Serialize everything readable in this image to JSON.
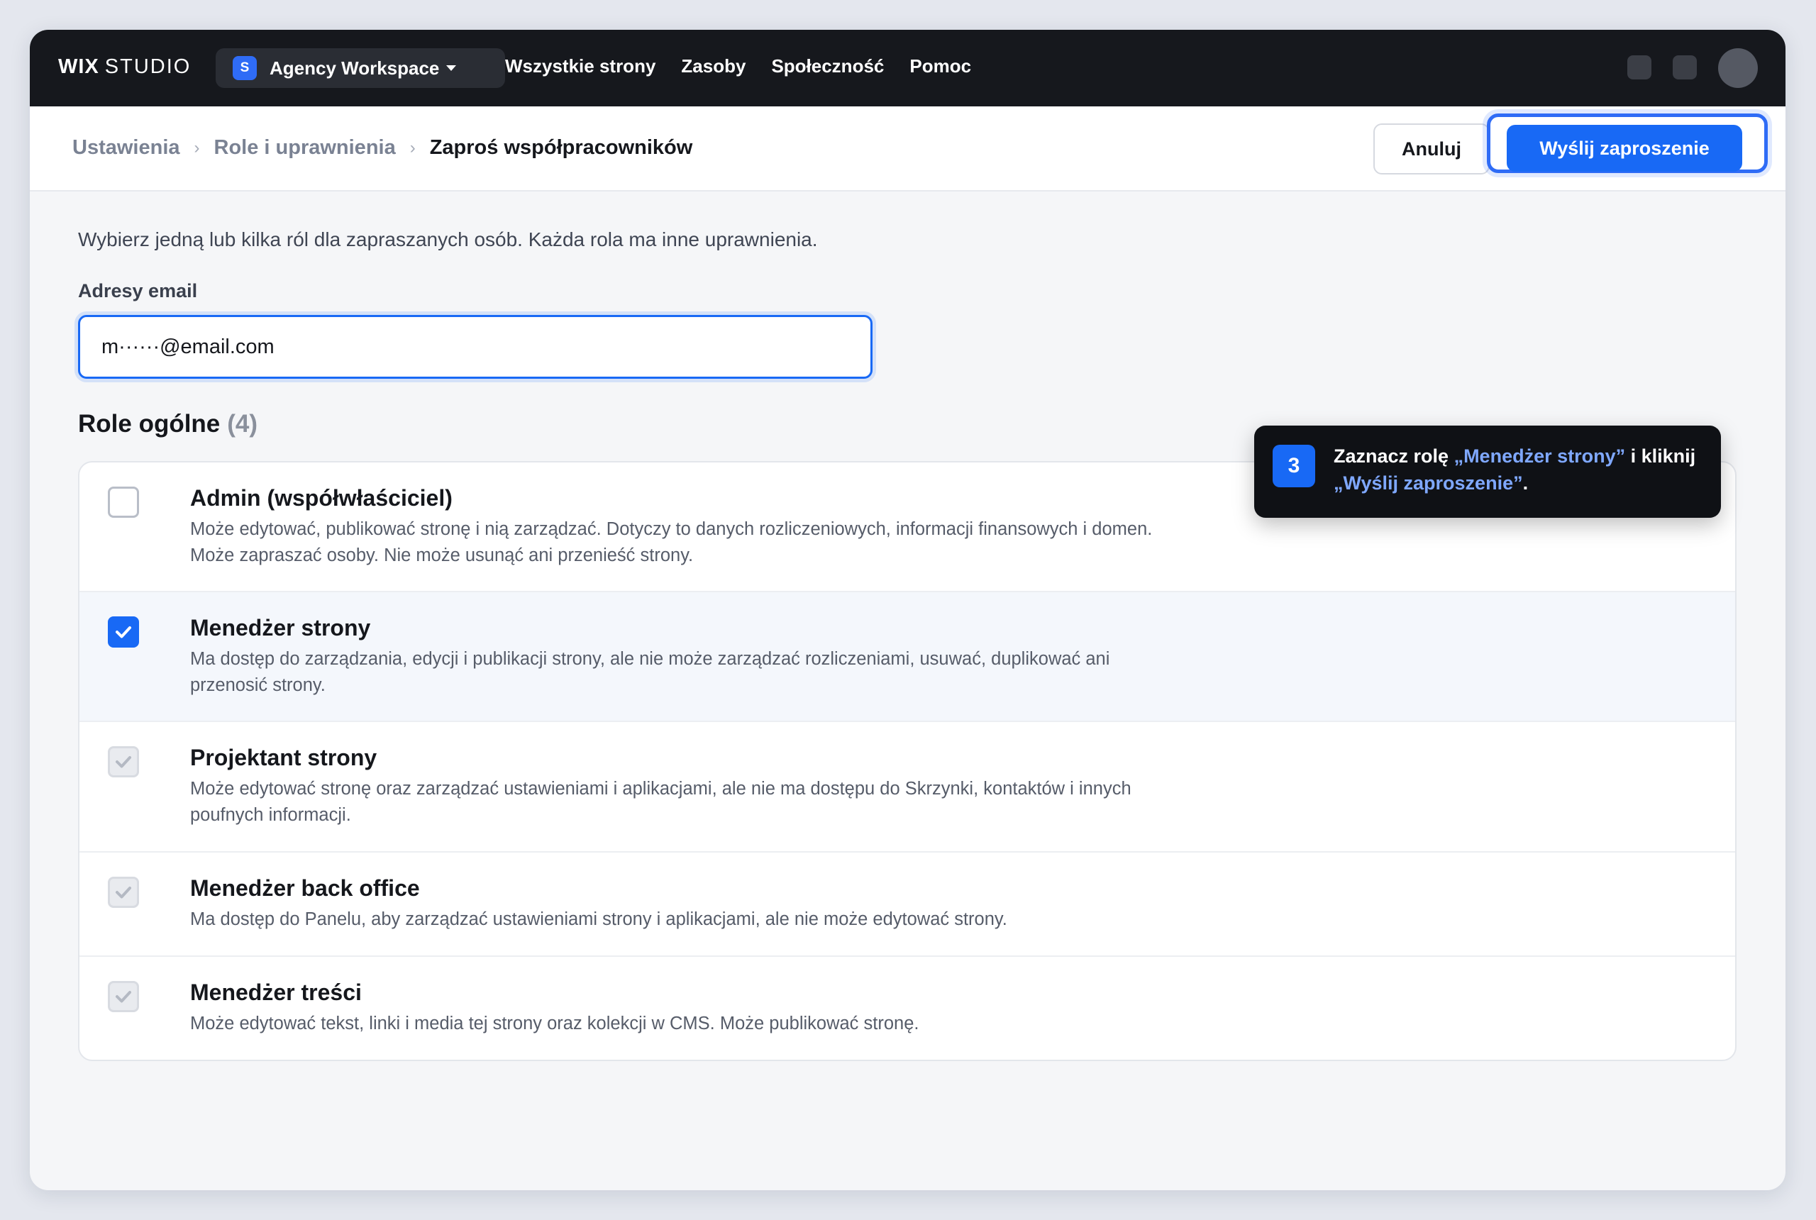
{
  "topbar": {
    "logo_bold": "WIX",
    "logo_light": "STUDIO",
    "workspace_badge": "S",
    "workspace_name": "Agency Workspace",
    "nav": [
      "Wszystkie strony",
      "Zasoby",
      "Społeczność",
      "Pomoc"
    ]
  },
  "header": {
    "breadcrumb": [
      "Ustawienia",
      "Role i uprawnienia",
      "Zaproś współpracowników"
    ],
    "separator": "›",
    "cancel_label": "Anuluj",
    "send_label": "Wyślij zaproszenie"
  },
  "content": {
    "intro": "Wybierz jedną lub kilka ról dla zapraszanych osób. Każda rola ma inne uprawnienia.",
    "email_label": "Adresy email",
    "email_value": "m······@email.com",
    "section_title": "Role ogólne",
    "section_count": "(4)"
  },
  "roles": [
    {
      "title": "Admin (współwłaściciel)",
      "desc_1": "Może edytować, publikować stronę i nią zarządzać. Dotyczy to danych rozliczeniowych, informacji finansowych i domen.",
      "desc_2": "Może zapraszać osoby. Nie może usunąć ani przenieść strony.",
      "state": "unchecked"
    },
    {
      "title": "Menedżer strony",
      "desc_1": "Ma dostęp do zarządzania, edycji i publikacji strony, ale nie może zarządzać rozliczeniami, usuwać, duplikować ani",
      "desc_2": "przenosić strony.",
      "state": "checked"
    },
    {
      "title": "Projektant strony",
      "desc_1": "Może edytować stronę oraz zarządzać ustawieniami i aplikacjami, ale nie ma dostępu do Skrzynki, kontaktów i innych",
      "desc_2": "poufnych informacji.",
      "state": "disabled-checked"
    },
    {
      "title": "Menedżer back office",
      "desc_1": "Ma dostęp do Panelu, aby zarządzać ustawieniami strony i aplikacjami, ale nie może edytować strony.",
      "state": "disabled-checked"
    },
    {
      "title": "Menedżer treści",
      "desc_1": "Może edytować tekst, linki i media tej strony oraz kolekcji w CMS. Może publikować stronę.",
      "state": "disabled-checked"
    }
  ],
  "tooltip": {
    "step": "3",
    "text_a": "Zaznacz rolę ",
    "highlight_1": "„Menedżer strony”",
    "text_b": " i kliknij ",
    "highlight_2": "„Wyślij zaproszenie”",
    "text_c": "."
  },
  "colors": {
    "accent": "#1869f5",
    "topbar_bg": "#16181d",
    "tooltip_bg": "#0f1115",
    "tooltip_highlight": "#7fa8ff"
  }
}
